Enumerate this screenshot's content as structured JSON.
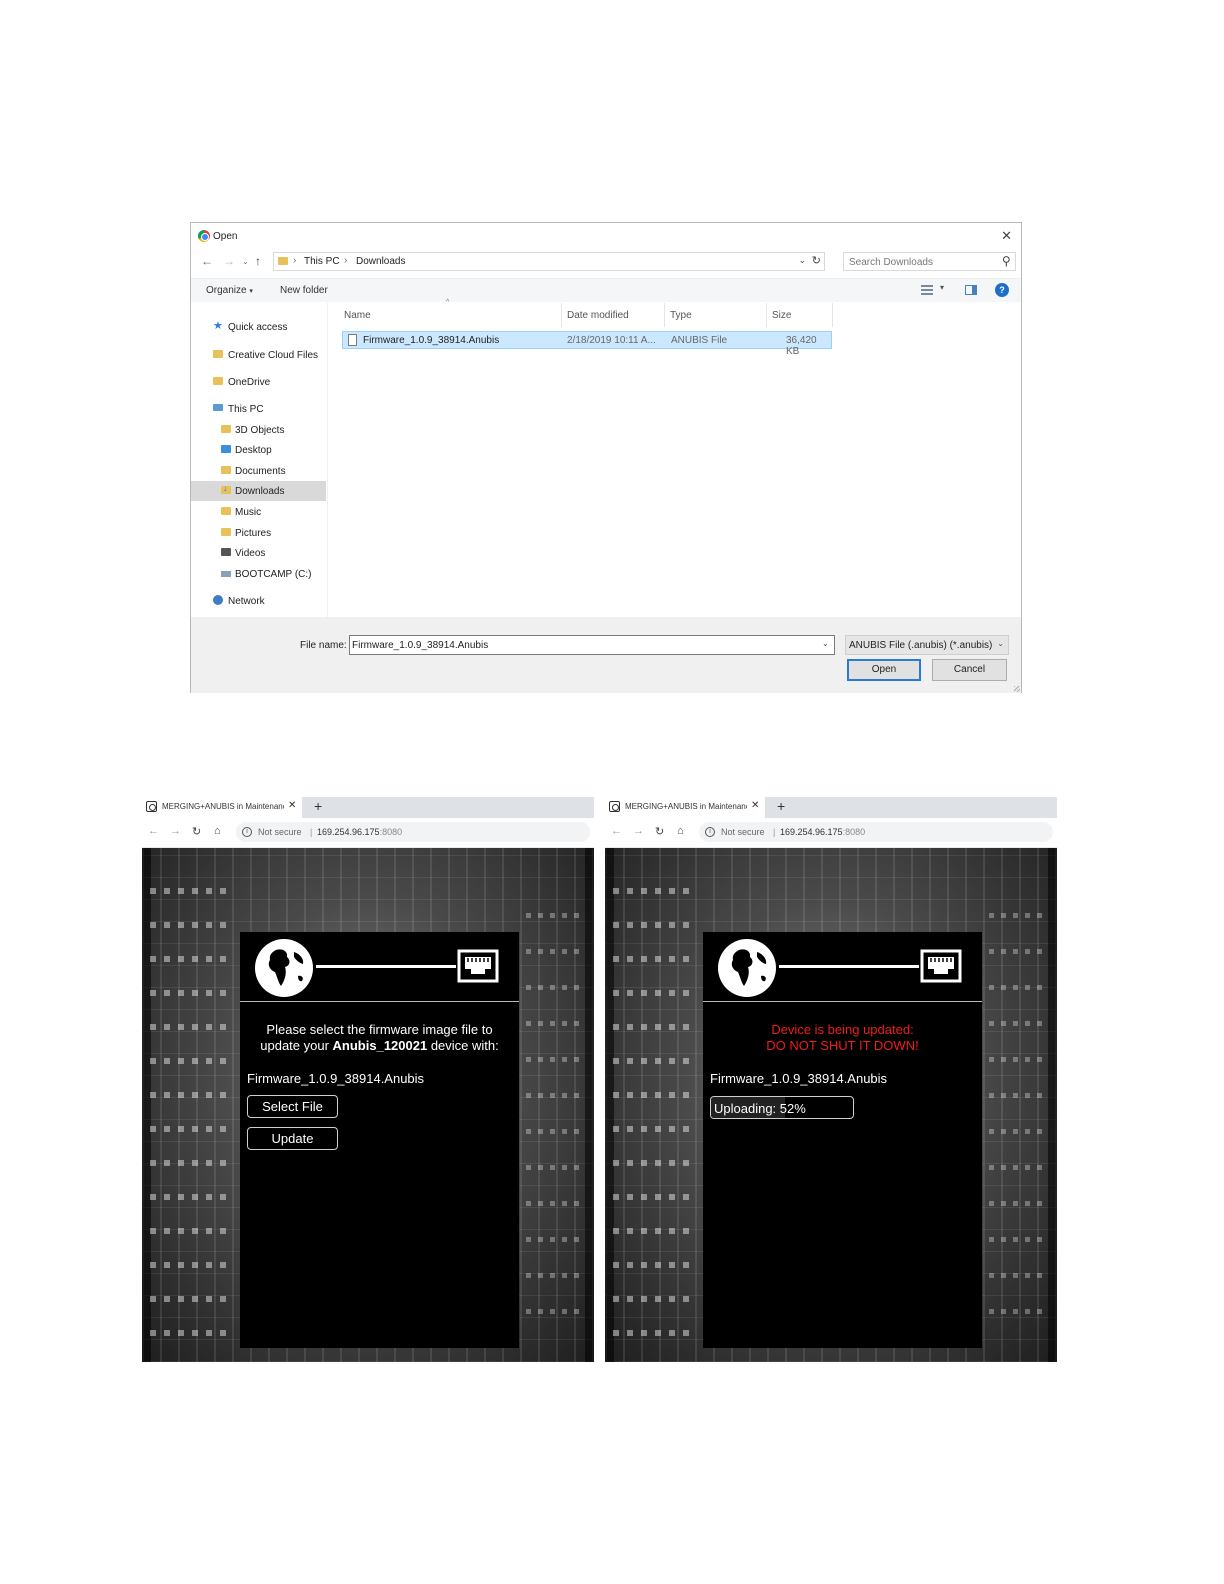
{
  "dialog": {
    "title": "Open",
    "address": {
      "crumbs": [
        "This PC",
        "Downloads"
      ]
    },
    "search_placeholder": "Search Downloads",
    "toolbar": {
      "organize": "Organize",
      "new_folder": "New folder"
    },
    "sidebar": [
      {
        "label": "Quick access",
        "icon": "star-icon"
      },
      {
        "label": "Creative Cloud Files",
        "icon": "folder-icon"
      },
      {
        "label": "OneDrive",
        "icon": "folder-icon"
      },
      {
        "label": "This PC",
        "icon": "computer-icon"
      },
      {
        "label": "3D Objects",
        "icon": "folder-icon"
      },
      {
        "label": "Desktop",
        "icon": "folder-icon"
      },
      {
        "label": "Documents",
        "icon": "folder-icon"
      },
      {
        "label": "Downloads",
        "icon": "download-folder-icon",
        "selected": true
      },
      {
        "label": "Music",
        "icon": "folder-icon"
      },
      {
        "label": "Pictures",
        "icon": "folder-icon"
      },
      {
        "label": "Videos",
        "icon": "folder-icon"
      },
      {
        "label": "BOOTCAMP (C:)",
        "icon": "drive-icon"
      },
      {
        "label": "Network",
        "icon": "network-icon"
      }
    ],
    "columns": {
      "name": "Name",
      "date": "Date modified",
      "type": "Type",
      "size": "Size"
    },
    "files": [
      {
        "name": "Firmware_1.0.9_38914.Anubis",
        "date": "2/18/2019 10:11 A...",
        "type": "ANUBIS File",
        "size": "36,420 KB"
      }
    ],
    "file_name_label": "File name:",
    "file_name_value": "Firmware_1.0.9_38914.Anubis",
    "file_type": "ANUBIS File (.anubis) (*.anubis)",
    "open_label": "Open",
    "cancel_label": "Cancel"
  },
  "browser_left": {
    "tab_title": "MERGING+ANUBIS in Maintenance",
    "not_secure": "Not secure",
    "separator": "|",
    "host": "169.254.96.175",
    "port": ":8080",
    "message_line1": "Please select the firmware image file to",
    "message_line2_prefix": "update your ",
    "device": "Anubis_120021",
    "message_line2_suffix": " device with:",
    "file_name": "Firmware_1.0.9_38914.Anubis",
    "select_label": "Select File",
    "update_label": "Update"
  },
  "browser_right": {
    "tab_title": "MERGING+ANUBIS in Maintenance",
    "not_secure": "Not secure",
    "separator": "|",
    "host": "169.254.96.175",
    "port": ":8080",
    "warning_line1": "Device is being updated:",
    "warning_line2": "DO NOT SHUT IT DOWN!",
    "file_name": "Firmware_1.0.9_38914.Anubis",
    "uploading_text": "Uploading: 52%",
    "progress_percent": 52
  },
  "colors": {
    "warning": "#ee1c1c",
    "selection": "#cce8ff",
    "accent": "#2b79d5"
  }
}
